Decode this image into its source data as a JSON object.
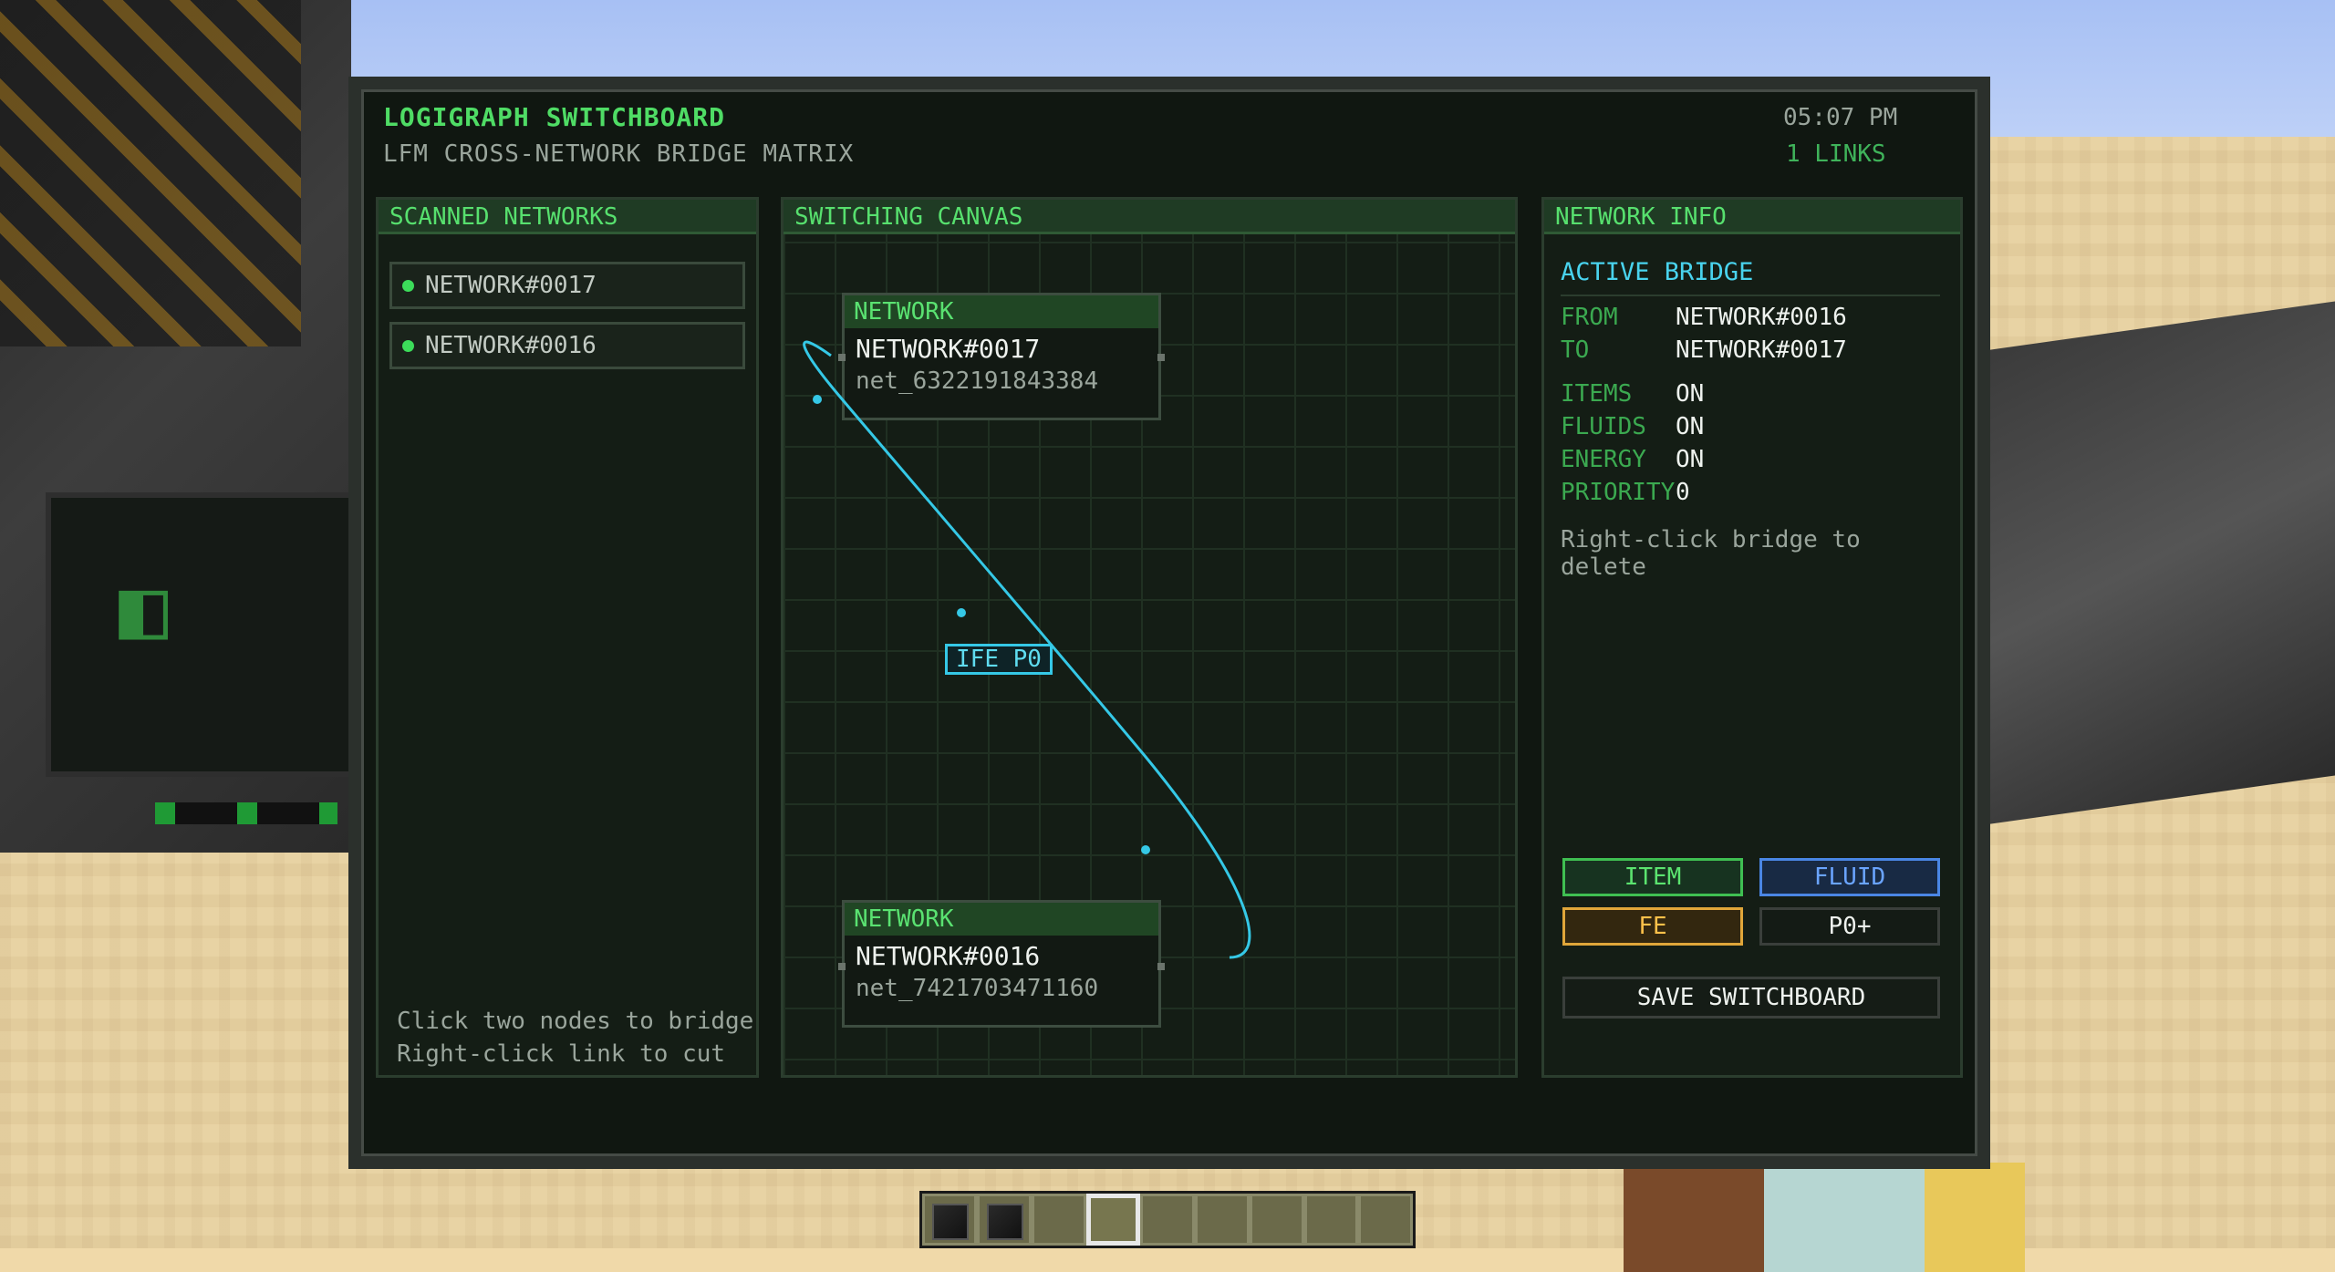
{
  "header": {
    "title": "LOGIGRAPH SWITCHBOARD",
    "subtitle": "LFM CROSS-NETWORK BRIDGE MATRIX",
    "clock": "05:07 PM",
    "links": "1 LINKS"
  },
  "scanned": {
    "heading": "SCANNED NETWORKS",
    "items": [
      {
        "label": "NETWORK#0017"
      },
      {
        "label": "NETWORK#0016"
      }
    ],
    "hint1": "Click two nodes to bridge",
    "hint2": "Right-click link to cut"
  },
  "canvas": {
    "heading": "SWITCHING CANVAS",
    "nodes": [
      {
        "head": "NETWORK",
        "name": "NETWORK#0017",
        "id": "net_6322191843384"
      },
      {
        "head": "NETWORK",
        "name": "NETWORK#0016",
        "id": "net_7421703471160"
      }
    ],
    "link_label": "IFE P0",
    "link_color": "#35c8e6"
  },
  "info": {
    "heading": "NETWORK INFO",
    "subheading": "ACTIVE BRIDGE",
    "rows": [
      {
        "k": "FROM",
        "v": "NETWORK#0016"
      },
      {
        "k": "TO",
        "v": "NETWORK#0017"
      },
      {
        "k": "ITEMS",
        "v": "ON"
      },
      {
        "k": "FLUIDS",
        "v": "ON"
      },
      {
        "k": "ENERGY",
        "v": "ON"
      },
      {
        "k": "PRIORITY",
        "v": "0"
      }
    ],
    "hint": "Right-click bridge to delete",
    "buttons": {
      "item": "ITEM",
      "fluid": "FLUID",
      "fe": "FE",
      "priority": "P0+",
      "save": "SAVE SWITCHBOARD"
    }
  },
  "hotbar": {
    "slots": 9,
    "selected": 3
  }
}
